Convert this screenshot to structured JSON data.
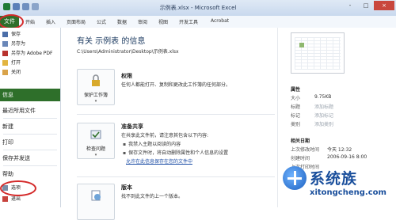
{
  "window": {
    "title": "示例表.xlsx - Microsoft Excel",
    "controls": [
      "-",
      "□",
      "×"
    ]
  },
  "ribbon": {
    "file_tab": "文件",
    "tabs": [
      "开始",
      "插入",
      "页面布局",
      "公式",
      "数据",
      "审阅",
      "视图",
      "开发工具",
      "Acrobat"
    ]
  },
  "nav": {
    "small_items": [
      {
        "label": "保存",
        "icon": "save-icon"
      },
      {
        "label": "另存为",
        "icon": "save-as-icon"
      },
      {
        "label": "另存为 Adobe PDF",
        "icon": "pdf-icon"
      },
      {
        "label": "打开",
        "icon": "open-folder-icon"
      },
      {
        "label": "关闭",
        "icon": "close-file-icon"
      }
    ],
    "info": "信息",
    "recent": "最近所用文件",
    "new": "新建",
    "print": "打印",
    "save_send": "保存并发送",
    "help": "帮助",
    "options": "选项",
    "exit": "退出"
  },
  "info": {
    "title": "有关 示例表 的信息",
    "path": "C:\\Users\\Administrator\\Desktop\\示例表.xlsx",
    "permissions": {
      "button": "保护工作簿",
      "title": "权限",
      "text": "任何人都能打开、复制和更改此工作簿的任何部分。"
    },
    "prepare": {
      "button": "检查问题",
      "title": "准备共享",
      "text": "在共享此文件前，请注意其包含以下内容:",
      "bullets": [
        "我禁入主题以阅读的内容",
        "保存文件时，将自动删除属性和个人信息的设置"
      ],
      "link": "允许在此信息保存在您的文件中"
    },
    "versions": {
      "button": "管理版本",
      "title": "版本",
      "text": "找不到此文件的上一个版本。"
    }
  },
  "properties": {
    "header": "属性",
    "rows": [
      {
        "k": "大小",
        "v": "9.75KB"
      },
      {
        "k": "标题",
        "v": "添加标题"
      },
      {
        "k": "标记",
        "v": "添加标记"
      },
      {
        "k": "类别",
        "v": "添加类别"
      }
    ],
    "dates_header": "相关日期",
    "dates": [
      {
        "k": "上次修改时间",
        "v": "今天 12:32"
      },
      {
        "k": "创建时间",
        "v": "2006-09-16 8:00"
      },
      {
        "k": "上次打印时间",
        "v": ""
      }
    ]
  },
  "watermark": {
    "title": "系统族",
    "url": "xitongcheng.com"
  },
  "colors": {
    "file_green": "#2e6f2a",
    "highlight_red": "#d42a2a",
    "link_blue": "#1f4fa6"
  }
}
